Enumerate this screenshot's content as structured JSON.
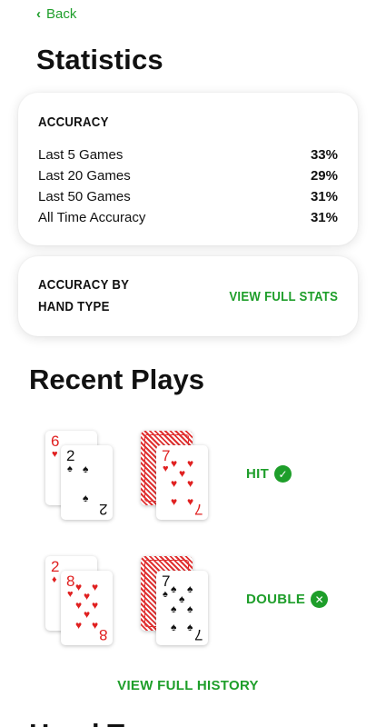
{
  "nav": {
    "back_label": "Back"
  },
  "page": {
    "title": "Statistics"
  },
  "accuracy": {
    "header": "ACCURACY",
    "rows": [
      {
        "label": "Last 5 Games",
        "value": "33%"
      },
      {
        "label": "Last 20 Games",
        "value": "29%"
      },
      {
        "label": "Last 50 Games",
        "value": "31%"
      },
      {
        "label": "All Time Accuracy",
        "value": "31%"
      }
    ]
  },
  "hand_type": {
    "title_line1": "ACCURACY BY",
    "title_line2": "HAND TYPE",
    "link": "VIEW FULL STATS"
  },
  "recent": {
    "title": "Recent Plays",
    "plays": [
      {
        "player": [
          {
            "rank": "6",
            "suit": "♥",
            "color": "red"
          },
          {
            "rank": "2",
            "suit": "♠",
            "color": "black"
          }
        ],
        "dealer": [
          {
            "rank": "7",
            "suit": "♥",
            "color": "red"
          }
        ],
        "result": "HIT",
        "status": "correct"
      },
      {
        "player": [
          {
            "rank": "2",
            "suit": "♦",
            "color": "red"
          },
          {
            "rank": "8",
            "suit": "♥",
            "color": "red"
          }
        ],
        "dealer": [
          {
            "rank": "7",
            "suit": "♠",
            "color": "black"
          }
        ],
        "result": "DOUBLE",
        "status": "incorrect"
      }
    ],
    "history_link": "VIEW FULL HISTORY"
  },
  "next_section": {
    "title": "Hand T"
  },
  "colors": {
    "accent": "#1e9e2a",
    "card_red": "#e02020"
  }
}
